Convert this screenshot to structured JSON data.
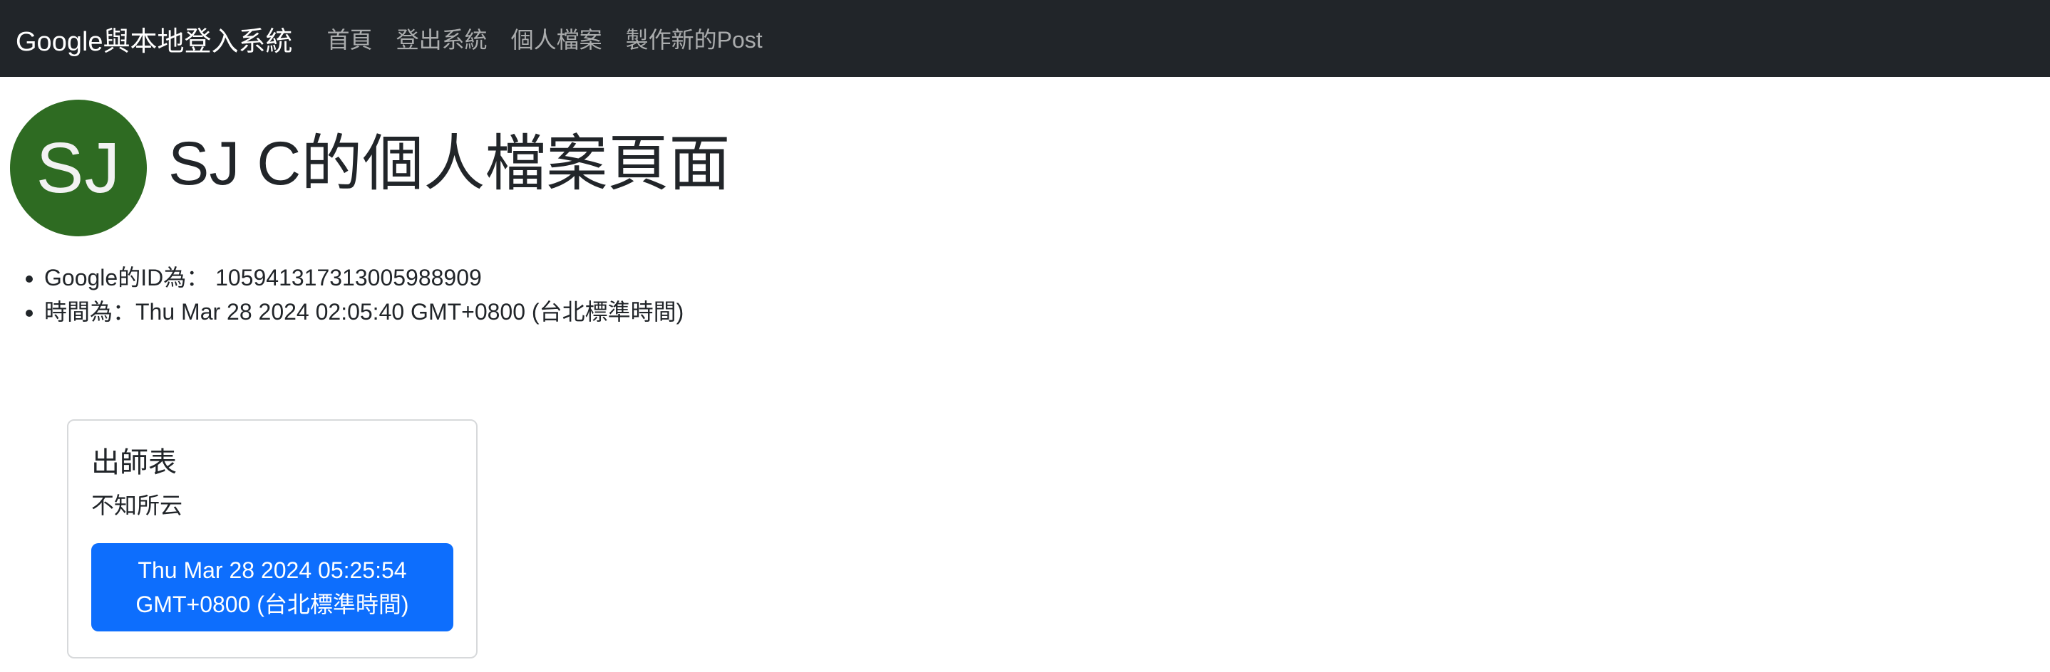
{
  "navbar": {
    "brand": "Google與本地登入系統",
    "links": [
      {
        "label": "首頁"
      },
      {
        "label": "登出系統"
      },
      {
        "label": "個人檔案"
      },
      {
        "label": "製作新的Post"
      }
    ]
  },
  "profile": {
    "avatar_initials": "SJ",
    "title": "SJ C的個人檔案頁面",
    "info": [
      {
        "text": "Google的ID為： 105941317313005988909"
      },
      {
        "text": "時間為：Thu Mar 28 2024 02:05:40 GMT+0800 (台北標準時間)"
      }
    ]
  },
  "posts": [
    {
      "title": "出師表",
      "content": "不知所云",
      "date_line1": "Thu Mar 28 2024 05:25:54",
      "date_line2": "GMT+0800 (台北標準時間)"
    }
  ],
  "colors": {
    "navbar_bg": "#212529",
    "avatar_bg": "#2e6b22",
    "button_primary": "#0d6efd"
  }
}
